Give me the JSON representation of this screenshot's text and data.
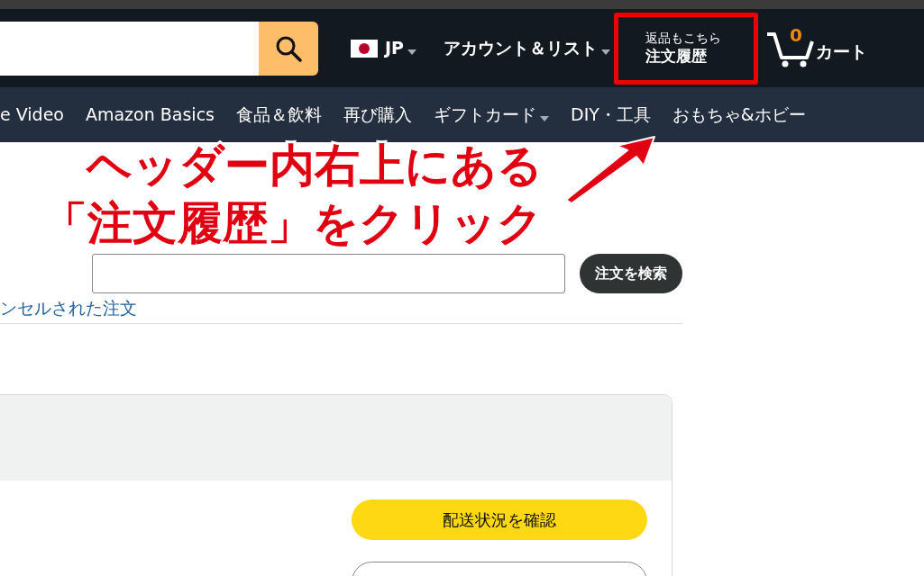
{
  "header": {
    "region": "JP",
    "account": "アカウント＆リスト",
    "orders": {
      "line1": "返品もこちら",
      "line2": "注文履歴",
      "highlighted": true
    },
    "cart": {
      "count": "0",
      "label": "カート"
    }
  },
  "nav": [
    {
      "label": "e Video",
      "has_menu": false
    },
    {
      "label": "Amazon Basics",
      "has_menu": false
    },
    {
      "label": "食品＆飲料",
      "has_menu": false
    },
    {
      "label": "再び購入",
      "has_menu": false
    },
    {
      "label": "ギフトカード",
      "has_menu": true
    },
    {
      "label": "DIY・工具",
      "has_menu": false
    },
    {
      "label": "おもちゃ&ホビー",
      "has_menu": false
    }
  ],
  "order_search": {
    "button": "注文を検索"
  },
  "link": "ンセルされた注文",
  "order_card": {
    "buttons": [
      {
        "label": "配送状況を確認",
        "kind": "primary"
      },
      {
        "kind": "secondary"
      }
    ]
  },
  "annotation": {
    "lines": [
      "ヘッダー内右上にある",
      "「注文履歴」をクリック"
    ]
  }
}
